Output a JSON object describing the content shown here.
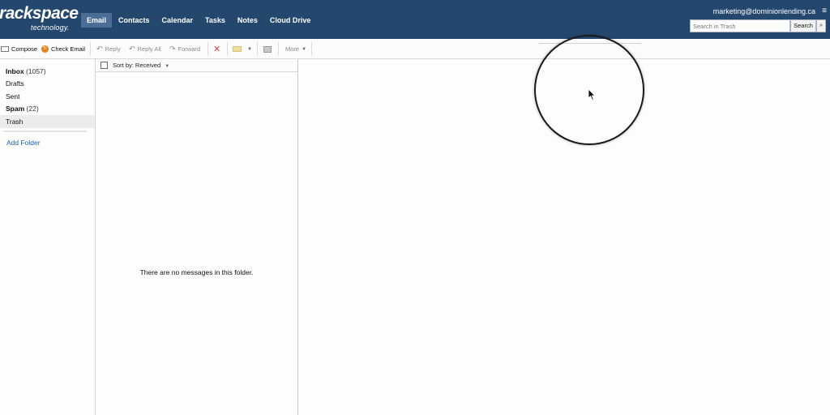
{
  "brand": {
    "name": "rackspace",
    "sub": "technology."
  },
  "nav": {
    "tabs": [
      {
        "label": "Email",
        "active": true
      },
      {
        "label": "Contacts"
      },
      {
        "label": "Calendar"
      },
      {
        "label": "Tasks"
      },
      {
        "label": "Notes"
      },
      {
        "label": "Cloud Drive"
      }
    ]
  },
  "account": {
    "email": "marketing@dominionlending.ca",
    "menu_icon": "hamburger-icon"
  },
  "search": {
    "placeholder": "Search in Trash",
    "button_label": "Search",
    "options_icon": "chevron-double-down-icon"
  },
  "toolbar": {
    "compose": "Compose",
    "check_email": "Check Email",
    "reply": "Reply",
    "reply_all": "Reply All",
    "forward": "Forward",
    "more": "More"
  },
  "sidebar": {
    "folders": [
      {
        "name": "Inbox",
        "count": "(1057)",
        "bold": true
      },
      {
        "name": "Drafts",
        "count": ""
      },
      {
        "name": "Sent",
        "count": ""
      },
      {
        "name": "Spam",
        "count": "(22)",
        "bold": true
      },
      {
        "name": "Trash",
        "count": "",
        "selected": true
      }
    ],
    "add_folder": "Add Folder"
  },
  "message_list": {
    "sort_label": "Sort by: Received",
    "empty_text": "There are no messages in this folder."
  },
  "colors": {
    "header_bg": "#24476e",
    "active_tab": "#4b6e97",
    "link": "#1b5fb3",
    "delete": "#d9483b"
  }
}
